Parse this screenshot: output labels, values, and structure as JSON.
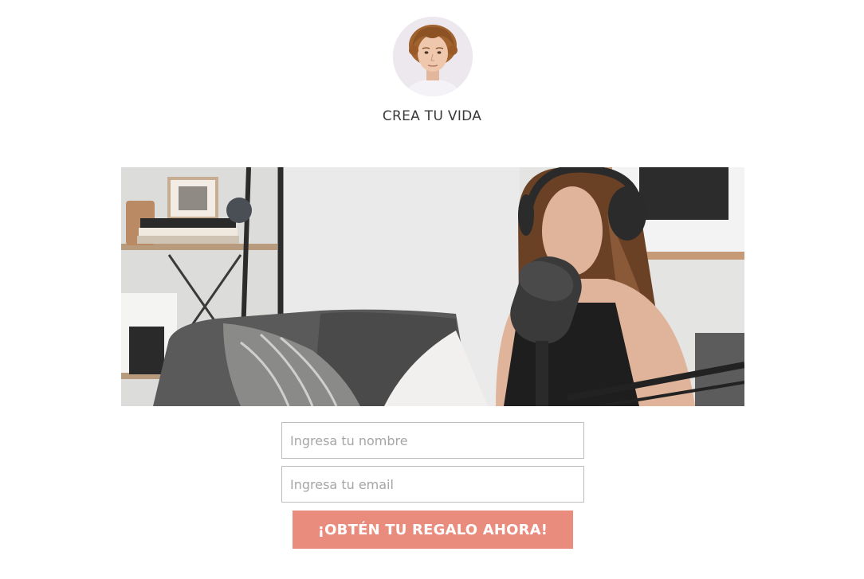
{
  "header": {
    "avatar_icon": "profile-photo-young-man",
    "title": "CREA TU VIDA"
  },
  "hero": {
    "image_icon": "podcast-woman-microphone-photo"
  },
  "form": {
    "name_placeholder": "Ingresa tu nombre",
    "name_value": "",
    "email_placeholder": "Ingresa tu email",
    "email_value": "",
    "submit_label": "¡OBTÉN TU REGALO AHORA!"
  },
  "colors": {
    "accent": "#e98c7e",
    "field_border": "#bdbdbd",
    "background": "#ffffff"
  }
}
